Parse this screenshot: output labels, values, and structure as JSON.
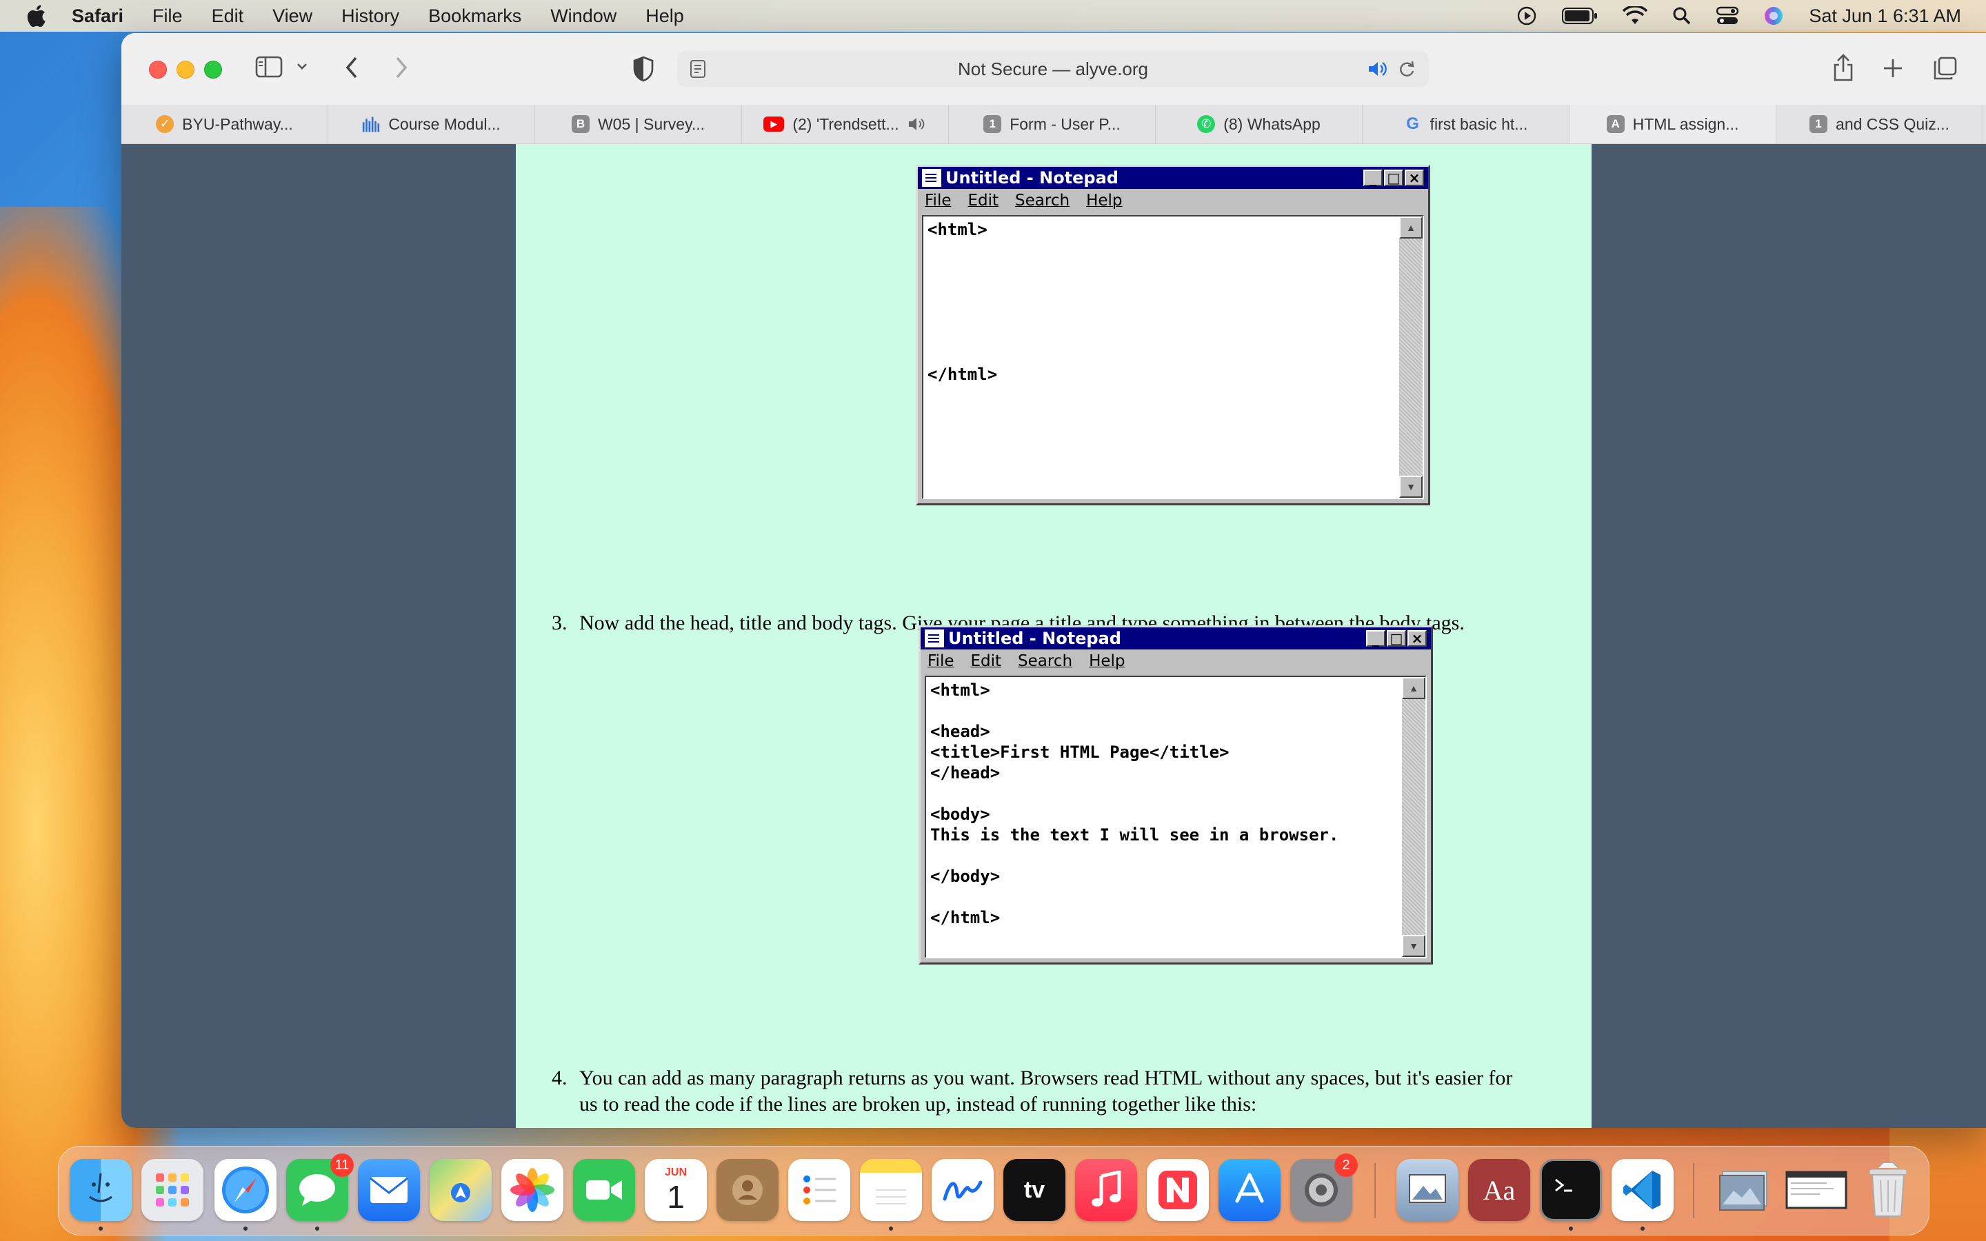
{
  "menubar": {
    "app_name": "Safari",
    "items": [
      "File",
      "Edit",
      "View",
      "History",
      "Bookmarks",
      "Window",
      "Help"
    ],
    "clock": "Sat Jun 1  6:31 AM"
  },
  "browser": {
    "address_text": "Not Secure — alyve.org"
  },
  "tabs": [
    {
      "label": "BYU-Pathway...",
      "icon": "pathway-icon",
      "color": "#f2a23a",
      "glyph": ""
    },
    {
      "label": "Course Modul...",
      "icon": "bars-icon",
      "color": "#2f6fd6",
      "glyph": ""
    },
    {
      "label": "W05 | Survey...",
      "icon": "b-icon",
      "color": "#8a8a8e",
      "glyph": "B"
    },
    {
      "label": "(2) 'Trendsett...",
      "icon": "youtube-icon",
      "color": "#ff0000",
      "glyph": "▶"
    },
    {
      "label": "Form - User P...",
      "icon": "number-icon",
      "color": "#8a8a8e",
      "glyph": "1"
    },
    {
      "label": "(8) WhatsApp",
      "icon": "whatsapp-icon",
      "color": "#25d366",
      "glyph": "✆"
    },
    {
      "label": "first basic ht...",
      "icon": "google-icon",
      "color": "#4285f4",
      "glyph": "G"
    },
    {
      "label": "HTML assign...",
      "icon": "a-icon",
      "color": "#8a8a8e",
      "glyph": "A"
    },
    {
      "label": "and CSS Quiz...",
      "icon": "number-icon",
      "color": "#8a8a8e",
      "glyph": "1"
    }
  ],
  "notepad": {
    "title": "Untitled - Notepad",
    "menu": [
      "File",
      "Edit",
      "Search",
      "Help"
    ]
  },
  "notepad1_code": "<html>\n\n\n\n\n\n\n</html>",
  "step3": {
    "num": "3.",
    "text": "Now add the head, title and body tags. Give your page a title and type something in between the body tags."
  },
  "notepad2_code": "<html>\n\n<head>\n<title>First HTML Page</title>\n</head>\n\n<body>\nThis is the text I will see in a browser.\n\n</body>\n\n</html>",
  "step4": {
    "num": "4.",
    "line1": "You can add as many paragraph returns as you want. Browsers read HTML without any spaces, but it's easier for",
    "line2": "us to read the code if the lines are broken up, instead of running together like this:"
  },
  "dock": {
    "messages_badge": "11",
    "settings_badge": "2",
    "calendar_month": "JUN",
    "calendar_day": "1",
    "tv_label": "tv",
    "dictionary_label": "Aa"
  }
}
